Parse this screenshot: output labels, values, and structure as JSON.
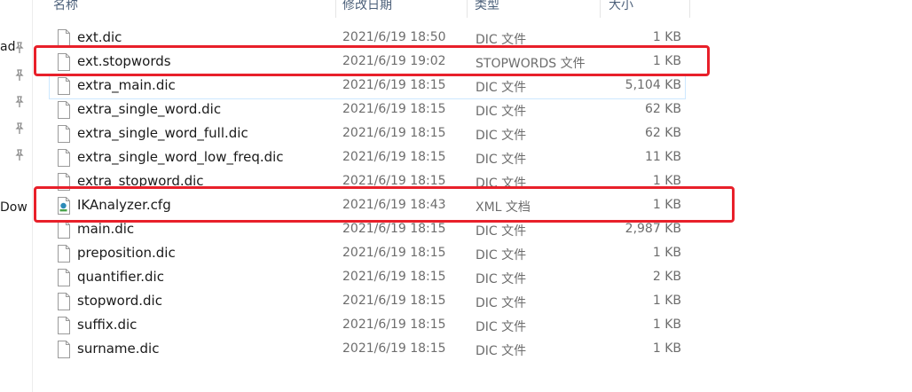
{
  "sidebar": {
    "labels": [
      "ad",
      "Dow"
    ]
  },
  "columns": {
    "name": "名称",
    "date": "修改日期",
    "type": "类型",
    "size": "大小"
  },
  "files": [
    {
      "name": "ext.dic",
      "date": "2021/6/19 18:50",
      "type": "DIC 文件",
      "size": "1 KB",
      "icon": "file-icon"
    },
    {
      "name": "ext.stopwords",
      "date": "2021/6/19 19:02",
      "type": "STOPWORDS 文件",
      "size": "1 KB",
      "icon": "file-icon"
    },
    {
      "name": "extra_main.dic",
      "date": "2021/6/19 18:15",
      "type": "DIC 文件",
      "size": "5,104 KB",
      "icon": "file-icon"
    },
    {
      "name": "extra_single_word.dic",
      "date": "2021/6/19 18:15",
      "type": "DIC 文件",
      "size": "62 KB",
      "icon": "file-icon"
    },
    {
      "name": "extra_single_word_full.dic",
      "date": "2021/6/19 18:15",
      "type": "DIC 文件",
      "size": "62 KB",
      "icon": "file-icon"
    },
    {
      "name": "extra_single_word_low_freq.dic",
      "date": "2021/6/19 18:15",
      "type": "DIC 文件",
      "size": "11 KB",
      "icon": "file-icon"
    },
    {
      "name": "extra_stopword.dic",
      "date": "2021/6/19 18:15",
      "type": "DIC 文件",
      "size": "1 KB",
      "icon": "file-icon"
    },
    {
      "name": "IKAnalyzer.cfg",
      "date": "2021/6/19 18:43",
      "type": "XML 文档",
      "size": "1 KB",
      "icon": "xml-file-icon"
    },
    {
      "name": "main.dic",
      "date": "2021/6/19 18:15",
      "type": "DIC 文件",
      "size": "2,987 KB",
      "icon": "file-icon"
    },
    {
      "name": "preposition.dic",
      "date": "2021/6/19 18:15",
      "type": "DIC 文件",
      "size": "1 KB",
      "icon": "file-icon"
    },
    {
      "name": "quantifier.dic",
      "date": "2021/6/19 18:15",
      "type": "DIC 文件",
      "size": "2 KB",
      "icon": "file-icon"
    },
    {
      "name": "stopword.dic",
      "date": "2021/6/19 18:15",
      "type": "DIC 文件",
      "size": "1 KB",
      "icon": "file-icon"
    },
    {
      "name": "suffix.dic",
      "date": "2021/6/19 18:15",
      "type": "DIC 文件",
      "size": "1 KB",
      "icon": "file-icon"
    },
    {
      "name": "surname.dic",
      "date": "2021/6/19 18:15",
      "type": "DIC 文件",
      "size": "1 KB",
      "icon": "file-icon"
    }
  ],
  "colors": {
    "highlight": "#e8202a",
    "header_text": "#4c607a",
    "meta_text": "#6d6d6d"
  }
}
